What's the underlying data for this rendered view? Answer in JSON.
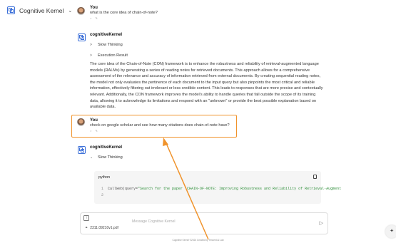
{
  "sidebar": {
    "app_title": "Cognitive Kernel"
  },
  "conversation": {
    "messages": [
      {
        "sender": "You",
        "text": "what is the core idea of chain-of-note?"
      },
      {
        "sender": "cognitiveKernel",
        "steps": [
          "Slow Thinking",
          "Execution Result"
        ],
        "text": "The core idea of the Chain-of-Note (CON) framework is to enhance the robustness and reliability of retrieval-augmented language models (RALMs) by generating a series of reading notes for retrieved documents. This approach allows for a comprehensive assessment of the relevance and accuracy of information retrieved from external documents. By creating sequential reading notes, the model not only evaluates the pertinence of each document to the input query but also pinpoints the most critical and reliable information, effectively filtering out irrelevant or less credible content. This leads to responses that are more precise and contextually relevant. Additionally, the CON framework improves the model's ability to handle queries that fall outside the scope of its training data, allowing it to acknowledge its limitations and respond with an \"unknown\" or provide the best possible explanation based on available data."
      },
      {
        "sender": "You",
        "text": "check on google scholar and see how many citations does chain-of-note have?"
      },
      {
        "sender": "cognitiveKernel",
        "steps": [
          "Slow Thinking"
        ],
        "code": {
          "language": "python",
          "lines": [
            {
              "num": "1",
              "prefix": "CallWeb(query=",
              "string": "\"Search for the paper 'CHAIN-OF-NOTE: Improving Robustness and Reliability of Retrieval-Augment"
            },
            {
              "num": "2",
              "prefix": "",
              "string": ""
            }
          ]
        }
      }
    ]
  },
  "composer": {
    "placeholder": "Message Cognitive Kernel",
    "attachment_name": "2311.09210v1.pdf"
  },
  "footer": {
    "text": "Cognitive Kernel ©2024 Created by Tencent AI Lab"
  },
  "colors": {
    "highlight": "#f0932b",
    "brand": "#3b6fd8",
    "code_string": "#2f8f3a"
  },
  "icons": [
    "app-logo-icon",
    "chevron-down-icon",
    "copy-icon",
    "attach-icon",
    "paperclip-icon",
    "send-icon",
    "wand-icon"
  ]
}
